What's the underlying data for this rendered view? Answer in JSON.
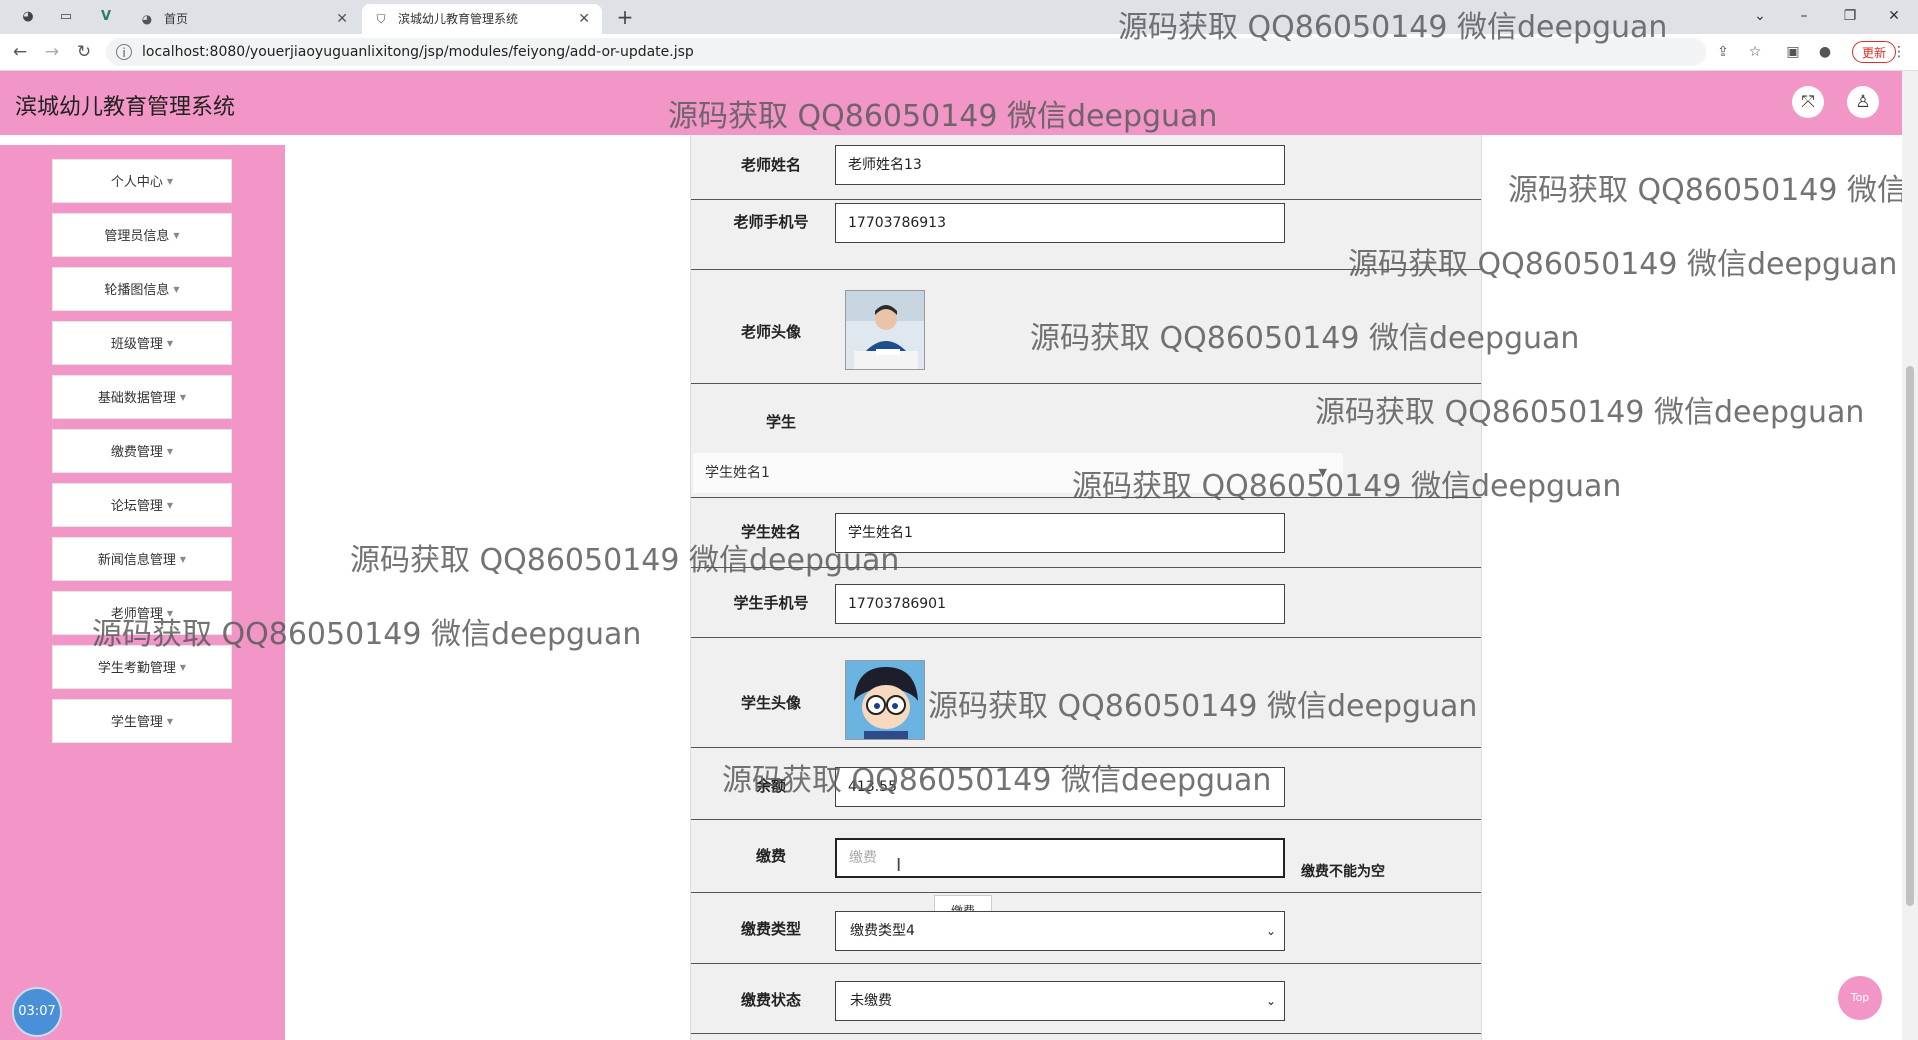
{
  "browser": {
    "tabs": [
      {
        "label": "首页"
      },
      {
        "label": "滨城幼儿教育管理系统"
      }
    ],
    "url": "localhost:8080/youerjiaoyuguanlixitong/jsp/modules/feiyong/add-or-update.jsp",
    "update_label": "更新"
  },
  "app": {
    "title": "滨城幼儿教育管理系统"
  },
  "sidebar": {
    "items": [
      {
        "label": "个人中心"
      },
      {
        "label": "管理员信息"
      },
      {
        "label": "轮播图信息"
      },
      {
        "label": "班级管理"
      },
      {
        "label": "基础数据管理"
      },
      {
        "label": "缴费管理"
      },
      {
        "label": "论坛管理"
      },
      {
        "label": "新闻信息管理"
      },
      {
        "label": "老师管理"
      },
      {
        "label": "学生考勤管理"
      },
      {
        "label": "学生管理"
      }
    ]
  },
  "form": {
    "teacher_name": {
      "label": "老师姓名",
      "value": "老师姓名13"
    },
    "teacher_phone": {
      "label": "老师手机号",
      "value": "17703786913"
    },
    "teacher_avatar": {
      "label": "老师头像"
    },
    "student": {
      "label": "学生",
      "selected": "学生姓名1"
    },
    "student_name": {
      "label": "学生姓名",
      "value": "学生姓名1"
    },
    "student_phone": {
      "label": "学生手机号",
      "value": "17703786901"
    },
    "student_avatar": {
      "label": "学生头像"
    },
    "balance": {
      "label": "余额",
      "value": "413.55"
    },
    "fee": {
      "label": "缴费",
      "placeholder": "缴费",
      "error": "缴费不能为空",
      "tooltip": "缴费"
    },
    "fee_type": {
      "label": "缴费类型",
      "selected": "缴费类型4"
    },
    "fee_status": {
      "label": "缴费状态",
      "selected": "未缴费"
    }
  },
  "clock": "03:07",
  "top_button": "Top",
  "watermark": "源码获取 QQ86050149 微信deepguan"
}
